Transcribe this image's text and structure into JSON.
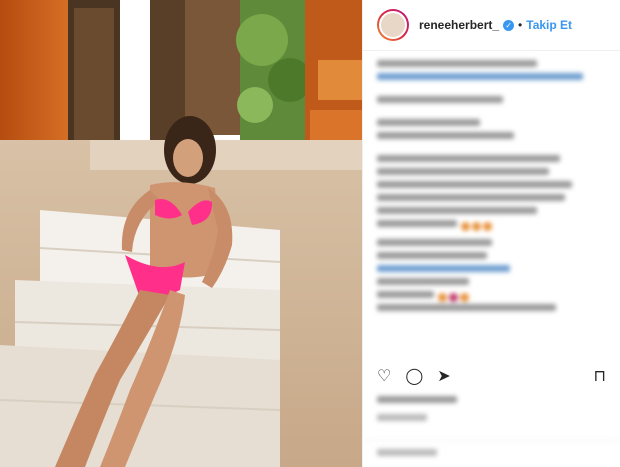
{
  "header": {
    "username": "reneeherbert_",
    "separator": "•",
    "follow_label": "Takip Et"
  },
  "icons": {
    "verified": "verified-badge-icon",
    "like": "heart-icon",
    "comment": "comment-icon",
    "share": "share-icon",
    "save": "bookmark-icon"
  },
  "colors": {
    "accent": "#3897f0",
    "text": "#262626",
    "border": "#efefef"
  }
}
